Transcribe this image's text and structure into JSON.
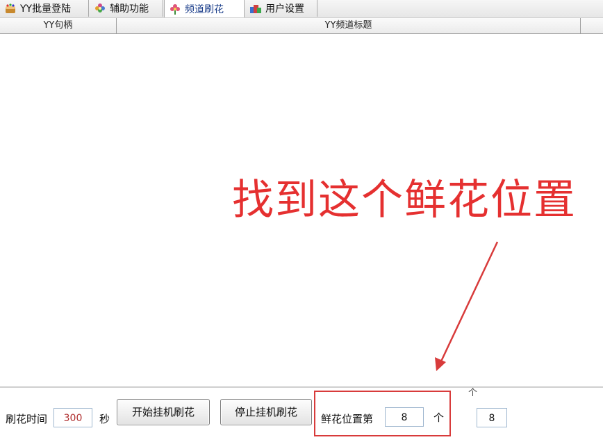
{
  "tabs": [
    {
      "label": "YY批量登陆",
      "icon": "cake-icon"
    },
    {
      "label": "辅助功能",
      "icon": "flower-icon"
    },
    {
      "label": "频道刷花",
      "icon": "flower-icon",
      "active": true
    },
    {
      "label": "用户设置",
      "icon": "users-icon"
    }
  ],
  "list": {
    "columns": [
      "YY句柄",
      "YY频道标题"
    ]
  },
  "annotation": {
    "text": "找到这个鲜花位置",
    "color": "#e53030"
  },
  "toolbar": {
    "interval_label": "刷花时间",
    "interval_value": "300",
    "interval_unit": "秒",
    "start_button": "开始挂机刷花",
    "stop_button": "停止挂机刷花",
    "position_label": "鲜花位置第",
    "position_value": "8",
    "position_unit": "个",
    "position_value_copy": "8",
    "up_mark": "个"
  }
}
